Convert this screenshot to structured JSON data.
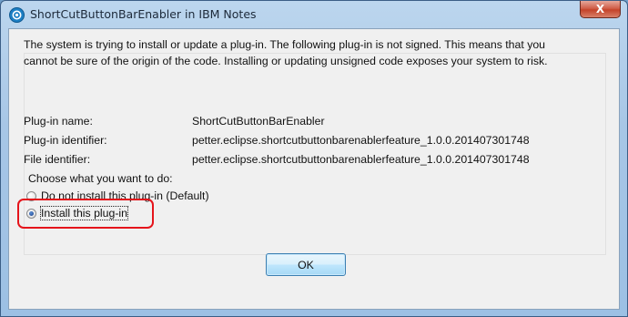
{
  "window": {
    "title": "ShortCutButtonBarEnabler in IBM Notes",
    "close_glyph": "X"
  },
  "dialog": {
    "message_line1": "The system is trying to install or update a plug-in.  The following plug-in is not signed.  This means that you",
    "message_line2": "cannot be sure of the origin of the code.  Installing or updating unsigned code exposes your system to risk.",
    "fields": [
      {
        "label": "Plug-in name:",
        "value": "ShortCutButtonBarEnabler"
      },
      {
        "label": "Plug-in identifier:",
        "value": "petter.eclipse.shortcutbuttonbarenablerfeature_1.0.0.201407301748"
      },
      {
        "label": "File identifier:",
        "value": "petter.eclipse.shortcutbuttonbarenablerfeature_1.0.0.201407301748"
      }
    ],
    "choose_label": "Choose what you want to do:",
    "options": [
      {
        "label": "Do not install this plug-in (Default)",
        "selected": false
      },
      {
        "label": "Install this plug-in",
        "selected": true
      }
    ],
    "ok_label": "OK"
  },
  "colors": {
    "highlight": "#e5141b",
    "titlebar": "#a7c6e6",
    "close": "#c4432a"
  }
}
